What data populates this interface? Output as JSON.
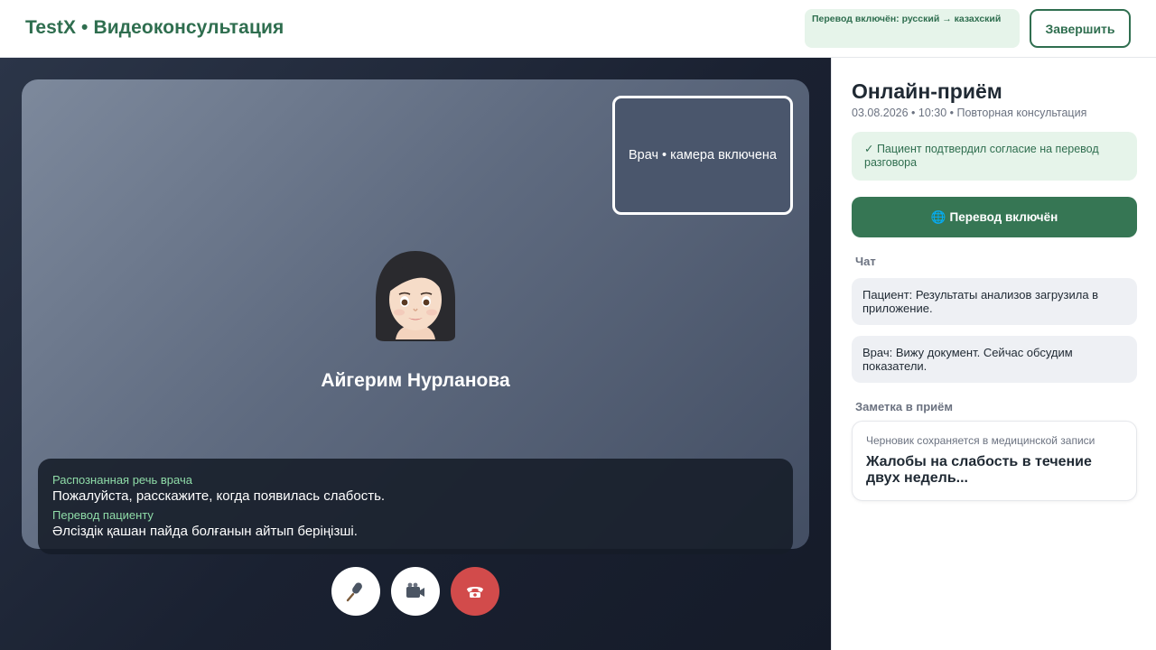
{
  "header": {
    "brand": "TestX • Видеоконсультация",
    "translation_status": "Перевод включён: русский → казахский",
    "end_label": "Завершить"
  },
  "video": {
    "self_view_label": "Врач • камера включена",
    "patient_name": "Айгерим Нурланова",
    "captions": {
      "recognized_label": "Распознанная речь врача",
      "recognized_text": "Пожалуйста, расскажите, когда появилась слабость.",
      "translation_label": "Перевод пациенту",
      "translation_text": "Әлсіздік қашан пайда болғанын айтып беріңізші."
    },
    "controls": [
      {
        "name": "microphone",
        "icon": "microphone-icon"
      },
      {
        "name": "camera",
        "icon": "video-camera-icon"
      },
      {
        "name": "end-call",
        "icon": "phone-icon",
        "color": "#d24b4b"
      }
    ]
  },
  "sidebar": {
    "title": "Онлайн-приём",
    "meta": "03.08.2026 • 10:30 • Повторная консультация",
    "consent": "✓ Пациент подтвердил согласие на перевод разговора",
    "translate_button": {
      "icon": "🌐",
      "label": "Перевод включён"
    },
    "chat_heading": "Чат",
    "chat": [
      {
        "text": "Пациент: Результаты анализов загрузила в приложение."
      },
      {
        "text": "Врач: Вижу документ. Сейчас обсудим показатели."
      }
    ],
    "note_heading": "Заметка в приём",
    "note_hint": "Черновик сохраняется в медицинской записи",
    "note_text": "Жалобы на слабость в течение двух недель..."
  },
  "colors": {
    "brand_green": "#2f6e4f",
    "button_green": "#367654",
    "end_call_red": "#d24b4b",
    "light_green_bg": "#e6f4ea"
  }
}
